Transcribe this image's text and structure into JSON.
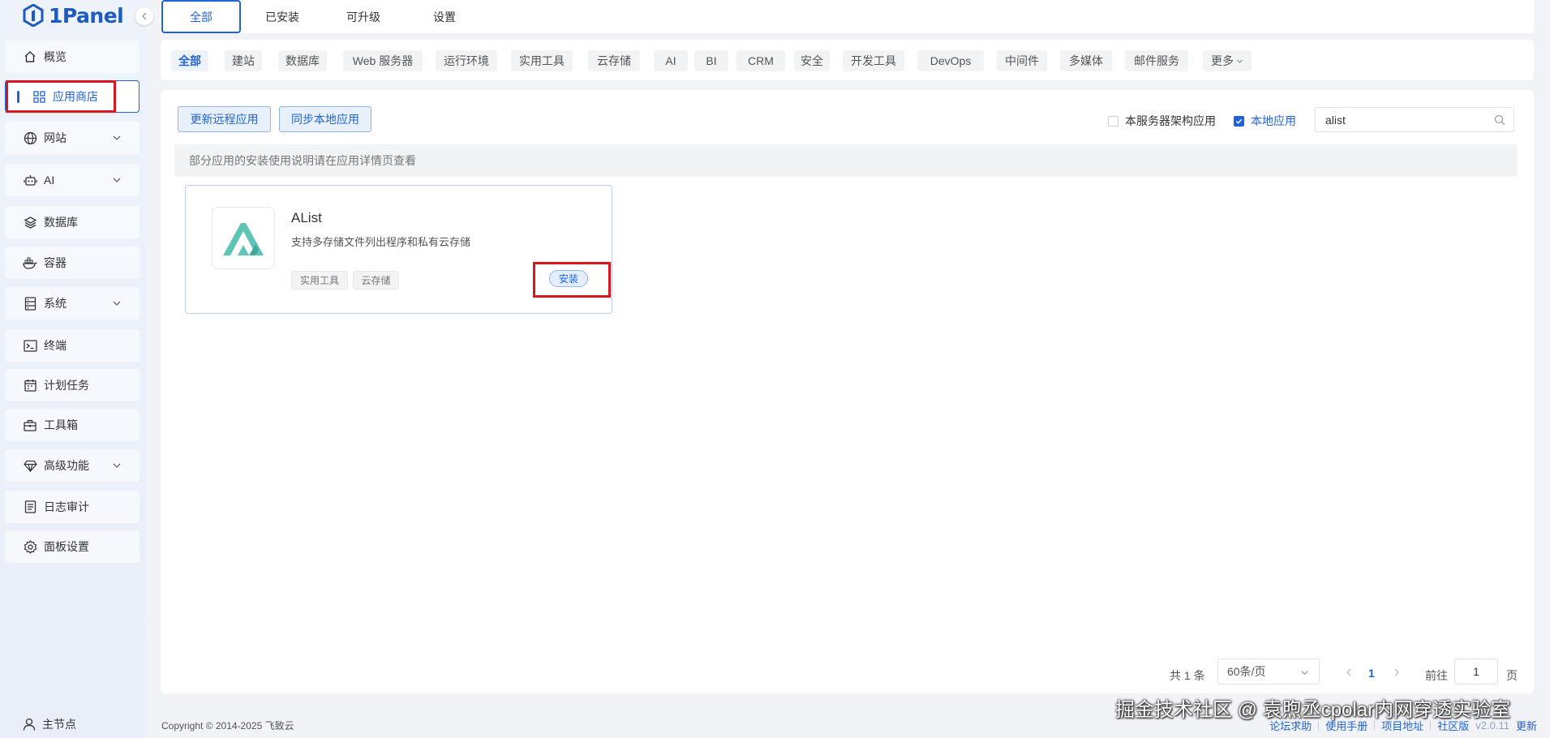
{
  "sidebar": {
    "logo_text": "1Panel",
    "items": [
      {
        "label": "概览",
        "icon": "home-icon"
      },
      {
        "label": "应用商店",
        "icon": "grid-icon"
      },
      {
        "label": "网站",
        "icon": "globe-icon"
      },
      {
        "label": "AI",
        "icon": "robot-icon"
      },
      {
        "label": "数据库",
        "icon": "layers-icon"
      },
      {
        "label": "容器",
        "icon": "docker-icon"
      },
      {
        "label": "系统",
        "icon": "server-icon"
      },
      {
        "label": "终端",
        "icon": "terminal-icon"
      },
      {
        "label": "计划任务",
        "icon": "calendar-icon"
      },
      {
        "label": "工具箱",
        "icon": "toolbox-icon"
      },
      {
        "label": "高级功能",
        "icon": "diamond-icon"
      },
      {
        "label": "日志审计",
        "icon": "log-icon"
      },
      {
        "label": "面板设置",
        "icon": "gear-icon"
      }
    ],
    "bottom_node": "主节点"
  },
  "top_tabs": [
    "全部",
    "已安装",
    "可升级",
    "设置"
  ],
  "categories": [
    "全部",
    "建站",
    "数据库",
    "Web 服务器",
    "运行环境",
    "实用工具",
    "云存储",
    "AI",
    "BI",
    "CRM",
    "安全",
    "开发工具",
    "DevOps",
    "中间件",
    "多媒体",
    "邮件服务",
    "更多"
  ],
  "toolbar": {
    "update_remote": "更新远程应用",
    "sync_local": "同步本地应用",
    "arch_filter": "本服务器架构应用",
    "local_apps": "本地应用",
    "search_value": "alist"
  },
  "notice": "部分应用的安装使用说明请在应用详情页查看",
  "app": {
    "name": "AList",
    "description": "支持多存储文件列出程序和私有云存储",
    "tags": [
      "实用工具",
      "云存储"
    ],
    "install_label": "安装"
  },
  "pagination": {
    "total": "共 1 条",
    "page_size": "60条/页",
    "current": "1",
    "goto_label": "前往",
    "goto_value": "1",
    "page_suffix": "页"
  },
  "footer": {
    "copyright": "Copyright © 2014-2025 飞致云",
    "links": [
      "论坛求助",
      "使用手册",
      "项目地址",
      "社区版"
    ],
    "version": "v2.0.11",
    "update": "更新"
  },
  "watermark": "掘金技术社区 @ 袁煦丞cpolar内网穿透实验室",
  "colors": {
    "accent": "#1f63d8",
    "highlight_box": "#d9161c"
  }
}
